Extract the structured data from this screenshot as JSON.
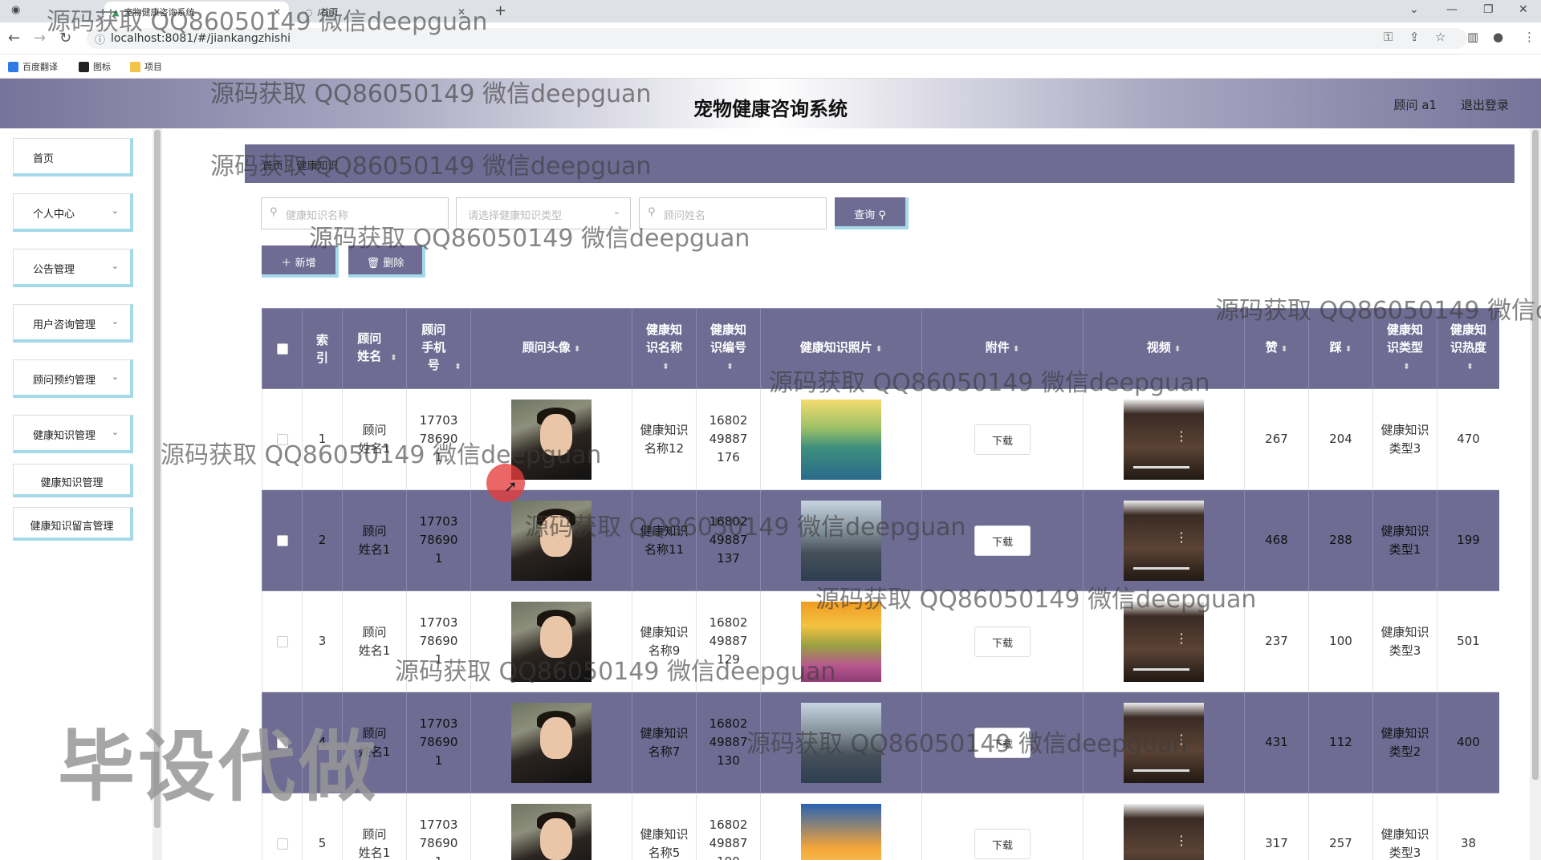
{
  "browser": {
    "tab_title": "宠物健康咨询系统",
    "tab2_title": "/首页",
    "url": "localhost:8081/#/jiankangzhishi",
    "bookmarks": [
      "百度翻译",
      "图标",
      "项目"
    ]
  },
  "header": {
    "title": "宠物健康咨询系统",
    "user": "顾问 a1",
    "logout": "退出登录"
  },
  "sidebar": {
    "items": [
      {
        "label": "首页"
      },
      {
        "label": "个人中心"
      },
      {
        "label": "公告管理"
      },
      {
        "label": "用户咨询管理"
      },
      {
        "label": "顾问预约管理"
      },
      {
        "label": "健康知识管理"
      }
    ],
    "subitems": [
      {
        "label": "健康知识管理"
      },
      {
        "label": "健康知识留言管理"
      }
    ]
  },
  "breadcrumb": {
    "home": "首页",
    "current": "健康知识"
  },
  "search": {
    "name_placeholder": "健康知识名称",
    "type_placeholder": "请选择健康知识类型",
    "advisor_placeholder": "顾问姓名",
    "query_label": "查询"
  },
  "actions": {
    "add_label": "新增",
    "delete_label": "删除"
  },
  "table": {
    "headers": {
      "index": "索引",
      "advisor_name": "顾问姓名",
      "advisor_phone": "顾问手机号",
      "advisor_avatar": "顾问头像",
      "name": "健康知识名称",
      "code": "健康知识编号",
      "photo": "健康知识照片",
      "attachment": "附件",
      "video": "视频",
      "likes": "赞",
      "dislikes": "踩",
      "type": "健康知识类型",
      "heat": "健康知识热度"
    },
    "download_label": "下载",
    "rows": [
      {
        "index": "1",
        "advisor_name": "顾问姓名1",
        "phone": "17703786901",
        "name": "健康知识名称12",
        "code": "1680249887176",
        "likes": "267",
        "dislikes": "204",
        "type": "健康知识类型3",
        "heat": "470"
      },
      {
        "index": "2",
        "advisor_name": "顾问姓名1",
        "phone": "17703786901",
        "name": "健康知识名称11",
        "code": "1680249887137",
        "likes": "468",
        "dislikes": "288",
        "type": "健康知识类型1",
        "heat": "199"
      },
      {
        "index": "3",
        "advisor_name": "顾问姓名1",
        "phone": "17703786901",
        "name": "健康知识名称9",
        "code": "1680249887129",
        "likes": "237",
        "dislikes": "100",
        "type": "健康知识类型3",
        "heat": "501"
      },
      {
        "index": "4",
        "advisor_name": "顾问姓名1",
        "phone": "17703786901",
        "name": "健康知识名称7",
        "code": "1680249887130",
        "likes": "431",
        "dislikes": "112",
        "type": "健康知识类型2",
        "heat": "400"
      },
      {
        "index": "5",
        "advisor_name": "顾问姓名1",
        "phone": "17703786901",
        "name": "健康知识名称5",
        "code": "1680249887190",
        "likes": "317",
        "dislikes": "257",
        "type": "健康知识类型3",
        "heat": "38"
      }
    ]
  },
  "watermark": {
    "text": "源码获取 QQ86050149 微信deepguan",
    "text_cut": "源码获取 QQ86050149 微信d",
    "big": "毕设代做"
  }
}
